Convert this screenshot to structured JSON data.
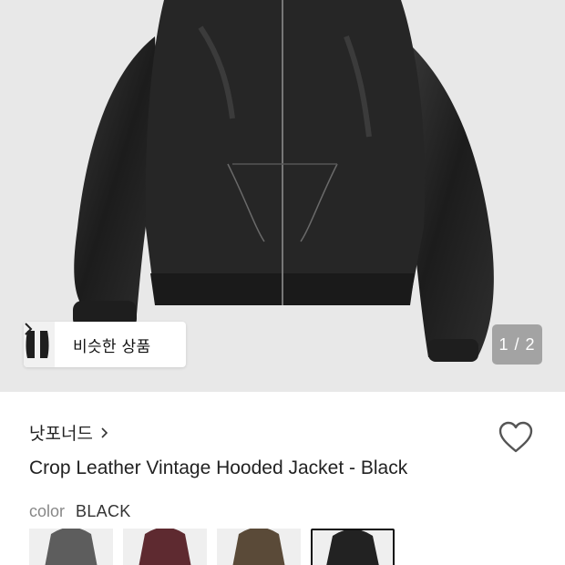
{
  "hero": {
    "similar_label": "비슷한 상품",
    "pager": "1 / 2"
  },
  "brand": {
    "name": "낫포너드"
  },
  "product": {
    "title": "Crop Leather Vintage Hooded Jacket - Black"
  },
  "color": {
    "key": "color",
    "value": "BLACK"
  },
  "colors": {
    "accent": "#111111",
    "background": "#e8e8e8"
  },
  "swatches": [
    {
      "name": "grey",
      "color": "#5d5d5d",
      "selected": false
    },
    {
      "name": "burgundy",
      "color": "#5e2a30",
      "selected": false
    },
    {
      "name": "brown",
      "color": "#5a4a38",
      "selected": false
    },
    {
      "name": "black",
      "color": "#222222",
      "selected": true
    }
  ]
}
